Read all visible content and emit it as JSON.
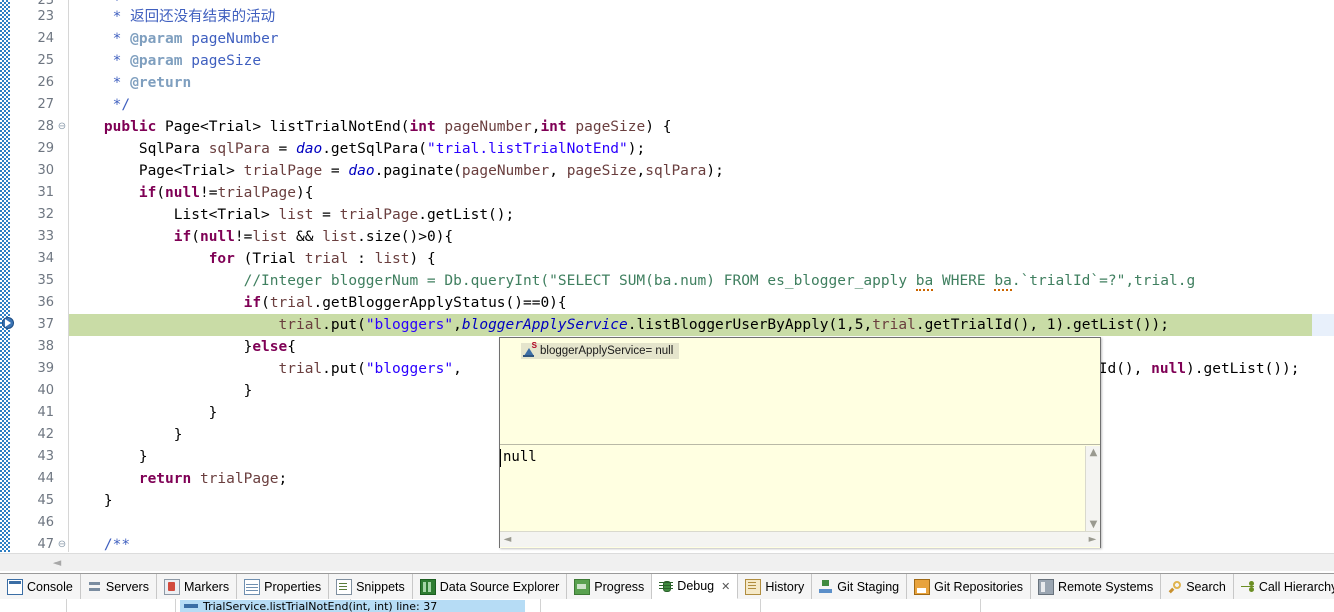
{
  "editor": {
    "first_line": 23,
    "highlight_line": 37,
    "lines": [
      {
        "num": 23,
        "fold": false,
        "indent": 0
      },
      {
        "num": 24,
        "fold": false,
        "indent": 0
      },
      {
        "num": 25,
        "fold": false,
        "indent": 0
      },
      {
        "num": 26,
        "fold": false,
        "indent": 0
      },
      {
        "num": 27,
        "fold": false,
        "indent": 0
      },
      {
        "num": 28,
        "fold": true,
        "indent": 0
      },
      {
        "num": 29,
        "fold": false,
        "indent": 0
      },
      {
        "num": 30,
        "fold": false,
        "indent": 0
      },
      {
        "num": 31,
        "fold": false,
        "indent": 0
      },
      {
        "num": 32,
        "fold": false,
        "indent": 0
      },
      {
        "num": 33,
        "fold": false,
        "indent": 0
      },
      {
        "num": 34,
        "fold": false,
        "indent": 0
      },
      {
        "num": 35,
        "fold": false,
        "indent": 0
      },
      {
        "num": 36,
        "fold": false,
        "indent": 0
      },
      {
        "num": 37,
        "fold": false,
        "indent": 0
      },
      {
        "num": 38,
        "fold": false,
        "indent": 0
      },
      {
        "num": 39,
        "fold": false,
        "indent": 0
      },
      {
        "num": 40,
        "fold": false,
        "indent": 0
      },
      {
        "num": 41,
        "fold": false,
        "indent": 0
      },
      {
        "num": 42,
        "fold": false,
        "indent": 0
      },
      {
        "num": 43,
        "fold": false,
        "indent": 0
      },
      {
        "num": 44,
        "fold": false,
        "indent": 0
      },
      {
        "num": 45,
        "fold": false,
        "indent": 0
      },
      {
        "num": 46,
        "fold": false,
        "indent": 0
      },
      {
        "num": 47,
        "fold": true,
        "indent": 0
      }
    ],
    "code_text": {
      "l23": "     * 返回还没有结束的活动",
      "l24": "     * @param pageNumber",
      "l25": "     * @param pageSize",
      "l26": "     * @return",
      "l27": "     */",
      "l28": "    public Page<Trial> listTrialNotEnd(int pageNumber,int pageSize) {",
      "l29": "        SqlPara sqlPara = dao.getSqlPara(\"trial.listTrialNotEnd\");",
      "l30": "        Page<Trial> trialPage = dao.paginate(pageNumber, pageSize,sqlPara);",
      "l31": "        if(null!=trialPage){",
      "l32": "            List<Trial> list = trialPage.getList();",
      "l33": "            if(null!=list && list.size()>0){",
      "l34": "                for (Trial trial : list) {",
      "l35": "                    //Integer bloggerNum = Db.queryInt(\"SELECT SUM(ba.num) FROM es_blogger_apply ba WHERE ba.`trialId`=?\",trial.g",
      "l36": "                    if(trial.getBloggerApplyStatus()==0){",
      "l37": "                        trial.put(\"bloggers\",bloggerApplyService.listBloggerUserByApply(1,5,trial.getTrialId(), 1).getList());",
      "l38": "                    }else{",
      "l39": "                        trial.put(\"bloggers\",",
      "l39b": "lId(), null).getList());",
      "l40": "                    }",
      "l41": "                }",
      "l42": "            }",
      "l43": "        }",
      "l44": "        return trialPage;",
      "l45": "    }",
      "l46": "",
      "l47": "    /**"
    },
    "gutter_marker": "debug-current-instruction-pointer"
  },
  "popup": {
    "annotation_label": "bloggerApplyService= null",
    "annotation_icon": "static-field-icon",
    "value": "null",
    "scroll_up": "▲",
    "scroll_down": "▼",
    "scroll_left": "◄",
    "scroll_right": "►"
  },
  "editor_scrollbar": {
    "left_arrow": "◄"
  },
  "tabbar": {
    "tabs": [
      {
        "label": "Console",
        "icon": "console-icon",
        "active": false,
        "closable": false
      },
      {
        "label": "Servers",
        "icon": "servers-icon",
        "active": false,
        "closable": false
      },
      {
        "label": "Markers",
        "icon": "markers-icon",
        "active": false,
        "closable": false
      },
      {
        "label": "Properties",
        "icon": "properties-icon",
        "active": false,
        "closable": false
      },
      {
        "label": "Snippets",
        "icon": "snippets-icon",
        "active": false,
        "closable": false
      },
      {
        "label": "Data Source Explorer",
        "icon": "database-icon",
        "active": false,
        "closable": false
      },
      {
        "label": "Progress",
        "icon": "progress-icon",
        "active": false,
        "closable": false
      },
      {
        "label": "Debug",
        "icon": "debug-bug-icon",
        "active": true,
        "closable": true
      },
      {
        "label": "History",
        "icon": "history-icon",
        "active": false,
        "closable": false
      },
      {
        "label": "Git Staging",
        "icon": "git-staging-icon",
        "active": false,
        "closable": false
      },
      {
        "label": "Git Repositories",
        "icon": "git-repo-icon",
        "active": false,
        "closable": false
      },
      {
        "label": "Remote Systems",
        "icon": "remote-icon",
        "active": false,
        "closable": false
      },
      {
        "label": "Search",
        "icon": "search-icon",
        "active": false,
        "closable": false
      },
      {
        "label": "Call Hierarchy",
        "icon": "call-hierarchy-icon",
        "active": false,
        "closable": false
      }
    ],
    "close_glyph": "✕"
  },
  "debug_view": {
    "selected_frame": "TrialService.listTrialNotEnd(int, int) line: 37"
  },
  "colors": {
    "keyword": "#7f0055",
    "string": "#2a00ff",
    "comment": "#3f7f5f",
    "javadoc": "#3f5fbf",
    "javadoc_tag": "#7f9fbf",
    "field": "#0000c0",
    "local_var": "#6a3e3e",
    "current_line_highlight": "#c9dca6",
    "popup_background": "#ffffe1",
    "changebar": "#2f7fc4",
    "selection": "#b6dcf5"
  }
}
